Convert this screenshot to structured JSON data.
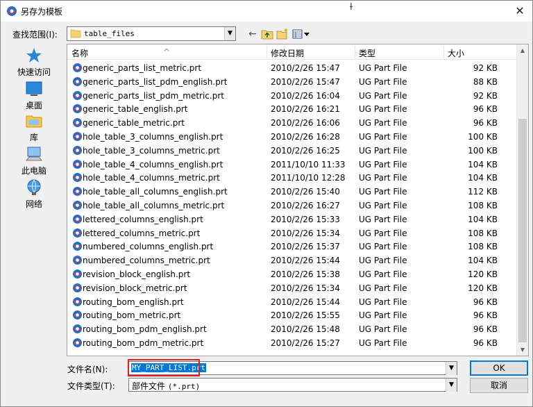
{
  "window": {
    "title": "另存为模板",
    "close_label": "✕"
  },
  "toolbar": {
    "look_in_label": "查找范围(I):",
    "look_in_value": "table_files",
    "back_icon": "back-arrow-icon",
    "up_icon": "up-folder-icon",
    "new_folder_icon": "new-folder-icon",
    "view_icon": "view-menu-icon"
  },
  "places": [
    {
      "label": "快速访问",
      "icon": "star-icon"
    },
    {
      "label": "桌面",
      "icon": "desktop-icon"
    },
    {
      "label": "库",
      "icon": "library-icon"
    },
    {
      "label": "此电脑",
      "icon": "computer-icon"
    },
    {
      "label": "网络",
      "icon": "network-icon"
    }
  ],
  "list": {
    "headers": {
      "name": "名称",
      "date": "修改日期",
      "type": "类型",
      "size": "大小"
    },
    "rows": [
      {
        "name": "generic_parts_list_metric.prt",
        "date": "2010/2/26 15:47",
        "type": "UG Part File",
        "size": "92 KB"
      },
      {
        "name": "generic_parts_list_pdm_english.prt",
        "date": "2010/2/26 15:47",
        "type": "UG Part File",
        "size": "88 KB"
      },
      {
        "name": "generic_parts_list_pdm_metric.prt",
        "date": "2010/2/26 16:04",
        "type": "UG Part File",
        "size": "92 KB"
      },
      {
        "name": "generic_table_english.prt",
        "date": "2010/2/26 16:21",
        "type": "UG Part File",
        "size": "96 KB"
      },
      {
        "name": "generic_table_metric.prt",
        "date": "2010/2/26 16:06",
        "type": "UG Part File",
        "size": "96 KB"
      },
      {
        "name": "hole_table_3_columns_english.prt",
        "date": "2010/2/26 16:28",
        "type": "UG Part File",
        "size": "100 KB"
      },
      {
        "name": "hole_table_3_columns_metric.prt",
        "date": "2010/2/26 16:25",
        "type": "UG Part File",
        "size": "100 KB"
      },
      {
        "name": "hole_table_4_columns_english.prt",
        "date": "2011/10/10 11:33",
        "type": "UG Part File",
        "size": "104 KB"
      },
      {
        "name": "hole_table_4_columns_metric.prt",
        "date": "2011/10/10 12:28",
        "type": "UG Part File",
        "size": "104 KB"
      },
      {
        "name": "hole_table_all_columns_english.prt",
        "date": "2010/2/26 15:40",
        "type": "UG Part File",
        "size": "112 KB"
      },
      {
        "name": "hole_table_all_columns_metric.prt",
        "date": "2010/2/26 16:27",
        "type": "UG Part File",
        "size": "108 KB"
      },
      {
        "name": "lettered_columns_english.prt",
        "date": "2010/2/26 15:33",
        "type": "UG Part File",
        "size": "104 KB"
      },
      {
        "name": "lettered_columns_metric.prt",
        "date": "2010/2/26 15:34",
        "type": "UG Part File",
        "size": "108 KB"
      },
      {
        "name": "numbered_columns_english.prt",
        "date": "2010/2/26 15:37",
        "type": "UG Part File",
        "size": "108 KB"
      },
      {
        "name": "numbered_columns_metric.prt",
        "date": "2010/2/26 15:44",
        "type": "UG Part File",
        "size": "104 KB"
      },
      {
        "name": "revision_block_english.prt",
        "date": "2010/2/26 15:38",
        "type": "UG Part File",
        "size": "120 KB"
      },
      {
        "name": "revision_block_metric.prt",
        "date": "2010/2/26 15:34",
        "type": "UG Part File",
        "size": "120 KB"
      },
      {
        "name": "routing_bom_english.prt",
        "date": "2010/2/26 15:44",
        "type": "UG Part File",
        "size": "96 KB"
      },
      {
        "name": "routing_bom_metric.prt",
        "date": "2010/2/26 15:55",
        "type": "UG Part File",
        "size": "96 KB"
      },
      {
        "name": "routing_bom_pdm_english.prt",
        "date": "2010/2/26 15:48",
        "type": "UG Part File",
        "size": "96 KB"
      },
      {
        "name": "routing_bom_pdm_metric.prt",
        "date": "2010/2/26 15:27",
        "type": "UG Part File",
        "size": "96 KB"
      }
    ]
  },
  "footer": {
    "filename_label": "文件名(N):",
    "filename_value": "MY_PART_LIST.prt",
    "filetype_label": "文件类型(T):",
    "filetype_value": "部件文件",
    "filetype_pattern": "(*.prt)",
    "ok_label": "OK",
    "cancel_label": "取消"
  },
  "colors": {
    "selection": "#0078d7",
    "highlight_box": "#e0201a",
    "icon_blue": "#2b6cc4"
  }
}
